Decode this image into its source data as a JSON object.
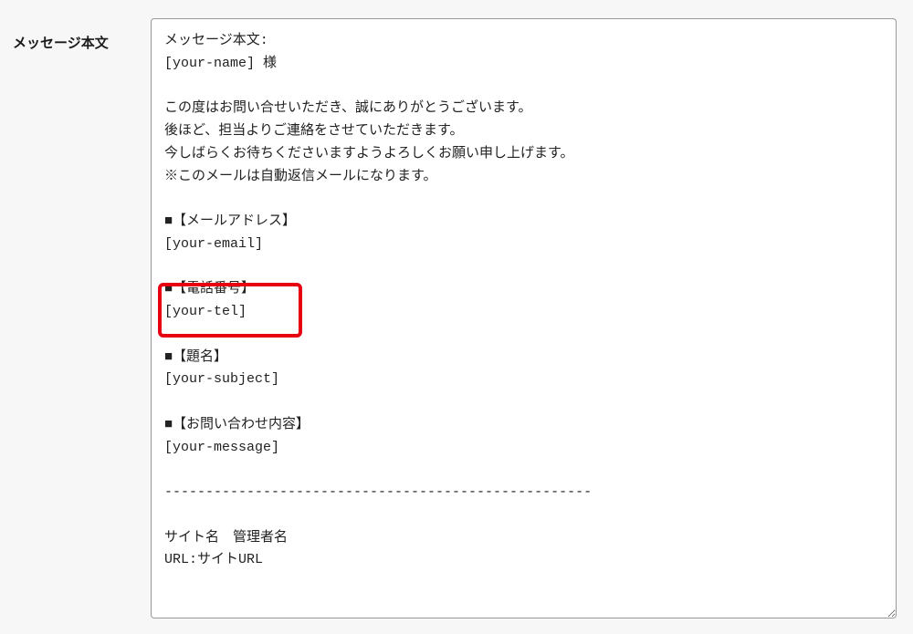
{
  "form": {
    "label": "メッセージ本文",
    "body": "メッセージ本文:\n[your-name] 様\n\nこの度はお問い合せいただき、誠にありがとうございます。\n後ほど、担当よりご連絡をさせていただきます。\n今しばらくお待ちくださいますようよろしくお願い申し上げます。\n※このメールは自動返信メールになります。\n\n■【メールアドレス】\n[your-email]\n\n■【電話番号】\n[your-tel]\n\n■【題名】\n[your-subject]\n\n■【お問い合わせ内容】\n[your-message]\n\n----------------------------------------------------\n\nサイト名　管理者名\nURL:サイトURL"
  },
  "highlight": {
    "target": "phone-section"
  }
}
